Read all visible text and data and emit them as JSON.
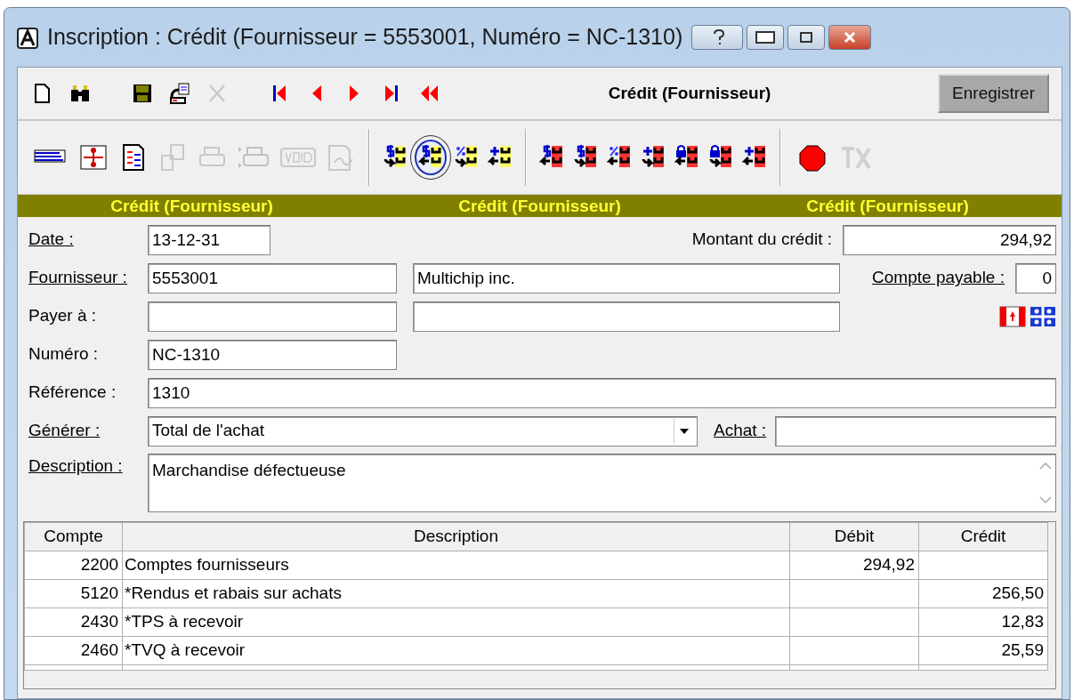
{
  "window": {
    "title": "Inscription : Crédit (Fournisseur = 5553001, Numéro = NC-1310)",
    "buttons": [
      {
        "kind": "help"
      },
      {
        "kind": "minimize"
      },
      {
        "kind": "maximize"
      },
      {
        "kind": "close"
      }
    ]
  },
  "toolbar": {
    "items": [
      {
        "kind": "new",
        "disabled": false
      },
      {
        "kind": "find",
        "disabled": false
      },
      {
        "kind": "gap"
      },
      {
        "kind": "save",
        "disabled": false
      },
      {
        "kind": "transfer",
        "disabled": false
      },
      {
        "kind": "delete",
        "disabled": true
      },
      {
        "kind": "gap"
      },
      {
        "kind": "first",
        "disabled": false
      },
      {
        "kind": "prev",
        "disabled": false
      },
      {
        "kind": "next",
        "disabled": false
      },
      {
        "kind": "last",
        "disabled": false
      },
      {
        "kind": "back",
        "disabled": false
      }
    ],
    "mode_label": "Crédit (Fournisseur)",
    "save_button": "Enregistrer"
  },
  "toolbar2": {
    "items": [
      {
        "kind": "lines",
        "disabled": false,
        "selected": false
      },
      {
        "kind": "tree",
        "disabled": false,
        "selected": false
      },
      {
        "kind": "report",
        "disabled": false,
        "selected": false
      },
      {
        "kind": "copy",
        "disabled": true,
        "selected": false
      },
      {
        "kind": "print",
        "disabled": true,
        "selected": false
      },
      {
        "kind": "printers",
        "disabled": true,
        "selected": false
      },
      {
        "kind": "void",
        "disabled": true,
        "selected": false
      },
      {
        "kind": "sign",
        "disabled": true,
        "selected": false
      },
      {
        "kind": "sep"
      },
      {
        "kind": "yellow-dollar",
        "disabled": false,
        "selected": false
      },
      {
        "kind": "yellow-dollar",
        "disabled": false,
        "selected": true
      },
      {
        "kind": "yellow-percent",
        "disabled": false,
        "selected": false
      },
      {
        "kind": "yellow-plus",
        "disabled": false,
        "selected": false
      },
      {
        "kind": "sep"
      },
      {
        "kind": "red-dollar",
        "disabled": false,
        "selected": false
      },
      {
        "kind": "red-dollar",
        "disabled": false,
        "selected": false
      },
      {
        "kind": "red-percent",
        "disabled": false,
        "selected": false
      },
      {
        "kind": "red-plus",
        "disabled": false,
        "selected": false
      },
      {
        "kind": "red-lock",
        "disabled": false,
        "selected": false
      },
      {
        "kind": "red-lock",
        "disabled": false,
        "selected": false
      },
      {
        "kind": "red-plus",
        "disabled": false,
        "selected": false
      },
      {
        "kind": "sep"
      },
      {
        "kind": "stop",
        "disabled": false,
        "selected": false
      },
      {
        "kind": "tx",
        "disabled": true,
        "selected": false
      }
    ]
  },
  "banner": [
    "Crédit (Fournisseur)",
    "Crédit (Fournisseur)",
    "Crédit (Fournisseur)"
  ],
  "form": {
    "date": {
      "label": "Date :",
      "underlined": true,
      "value": "13-12-31"
    },
    "amount": {
      "label": "Montant du crédit :",
      "underlined": false,
      "value": "294,92"
    },
    "supplier": {
      "label": "Fournisseur :",
      "underlined": true,
      "value": "5553001",
      "name": "Multichip inc."
    },
    "payable": {
      "label": "Compte payable :",
      "underlined": true,
      "value": "0"
    },
    "pay_to": {
      "label": "Payer à :",
      "underlined": false
    },
    "number": {
      "label": "Numéro :",
      "underlined": false,
      "value": "NC-1310"
    },
    "reference": {
      "label": "Référence :",
      "underlined": false,
      "value": "1310"
    },
    "generate": {
      "label": "Générer :",
      "underlined": true,
      "value": "Total de l'achat"
    },
    "purchase": {
      "label": "Achat :",
      "underlined": true
    },
    "description": {
      "label": "Description :",
      "underlined": true,
      "value": "Marchandise défectueuse"
    }
  },
  "table": {
    "columns": [
      "Compte",
      "Description",
      "Débit",
      "Crédit"
    ],
    "rows": [
      [
        "2200",
        "Comptes fournisseurs",
        "294,92",
        ""
      ],
      [
        "5120",
        "*Rendus et rabais sur achats",
        "",
        "256,50"
      ],
      [
        "2430",
        "*TPS à recevoir",
        "",
        "12,83"
      ],
      [
        "2460",
        "*TVQ à recevoir",
        "",
        "25,59"
      ]
    ]
  }
}
